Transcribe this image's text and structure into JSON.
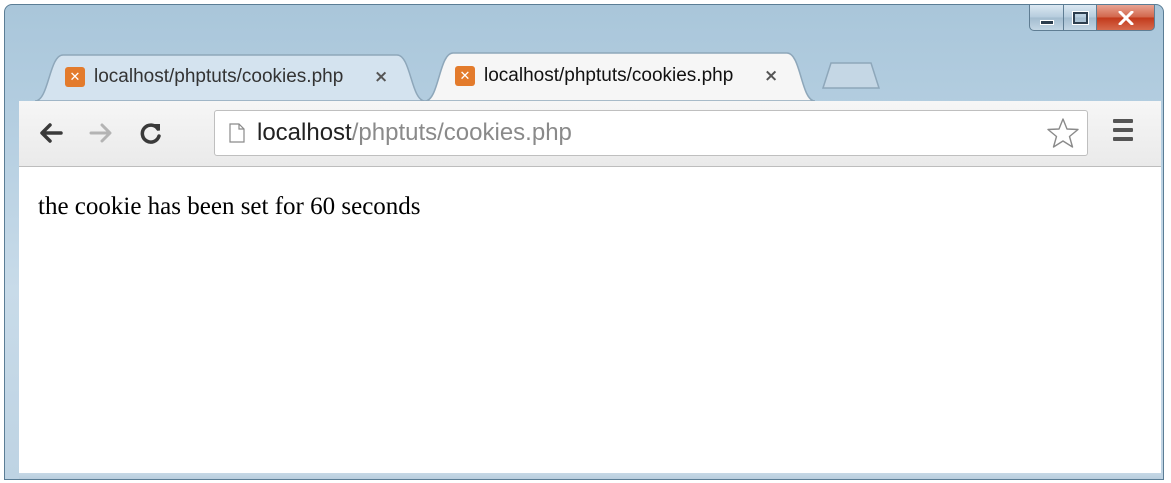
{
  "window": {
    "caption_buttons": {
      "minimize": "minimize",
      "maximize": "maximize",
      "close": "close"
    }
  },
  "tabs": [
    {
      "title": "localhost/phptuts/cookies.php",
      "active": false,
      "close_label": "×",
      "favicon": "xampp-icon"
    },
    {
      "title": "localhost/phptuts/cookies.php",
      "active": true,
      "close_label": "×",
      "favicon": "xampp-icon"
    }
  ],
  "toolbar": {
    "back_icon": "back-arrow-icon",
    "forward_icon": "forward-arrow-icon",
    "reload_icon": "reload-icon",
    "url_host": "localhost",
    "url_path": "/phptuts/cookies.php",
    "star_icon": "bookmark-star-icon",
    "menu_icon": "menu-icon"
  },
  "page": {
    "text": "the cookie has been set for 60 seconds"
  },
  "colors": {
    "frame": "#b7d0e2",
    "close_button": "#c2391b",
    "favicon": "#e37b2c",
    "url_path": "#8a8a8a"
  }
}
